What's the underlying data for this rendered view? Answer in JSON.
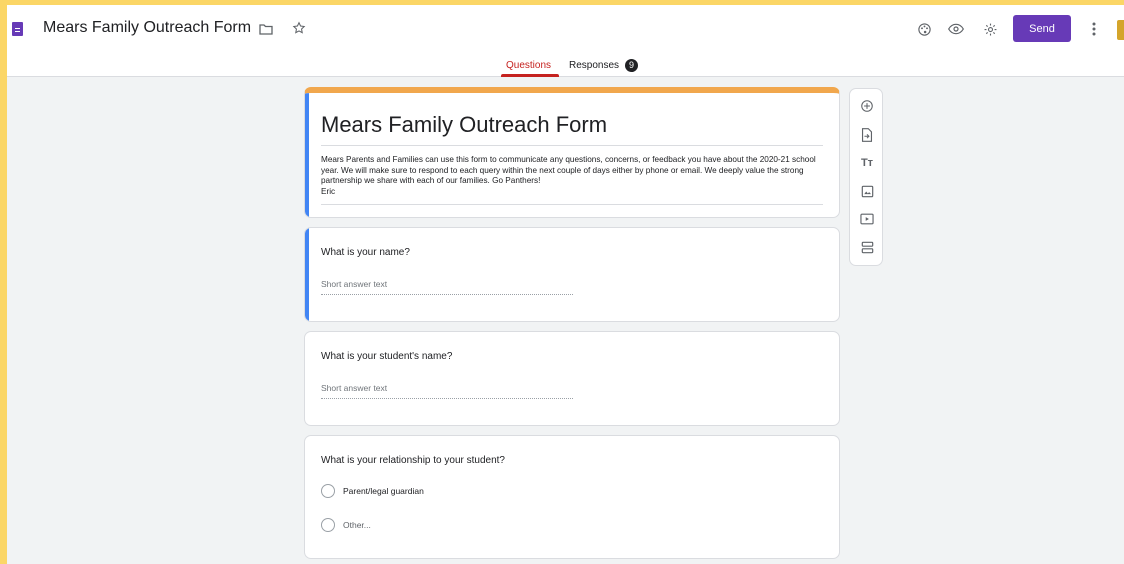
{
  "header": {
    "title": "Mears Family Outreach Form",
    "send_label": "Send"
  },
  "tabs": {
    "questions": "Questions",
    "responses": "Responses",
    "responses_count": "9"
  },
  "form": {
    "title": "Mears Family Outreach Form",
    "description": "Mears Parents and Families can use this form to communicate any questions, concerns, or feedback you have about the 2020-21 school year.  We will make sure to respond to each query within the next couple of days either by phone or email.  We deeply value the strong partnership we share with each of our families.  Go Panthers!",
    "signature": "Eric"
  },
  "questions": [
    {
      "text": "What is your name?",
      "placeholder": "Short answer text"
    },
    {
      "text": "What is your student's name?",
      "placeholder": "Short answer text"
    },
    {
      "text": "What is your relationship to your student?",
      "options": [
        "Parent/legal guardian",
        "Other..."
      ]
    }
  ],
  "colors": {
    "frame": "#fbd666",
    "accent": "#673ab7",
    "header_bar": "#f1a74d",
    "active_tab": "#c5221f",
    "focus_bar": "#4285f4"
  },
  "icons": [
    "docs-icon",
    "folder-icon",
    "star-icon",
    "palette-icon",
    "preview-eye-icon",
    "settings-gear-icon",
    "more-vert-icon",
    "add-question-icon",
    "import-questions-icon",
    "add-title-icon",
    "add-image-icon",
    "add-video-icon",
    "add-section-icon"
  ]
}
